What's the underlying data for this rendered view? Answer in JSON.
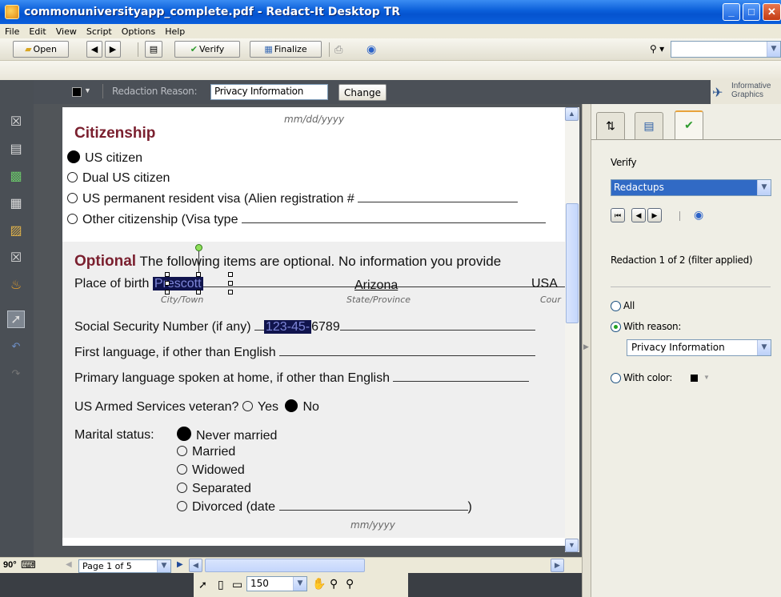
{
  "window": {
    "title": "commonuniversityapp_complete.pdf - Redact-It Desktop TR"
  },
  "menu": [
    "File",
    "Edit",
    "View",
    "Script",
    "Options",
    "Help"
  ],
  "toolbar": {
    "open": "Open",
    "verify": "Verify",
    "finalize": "Finalize"
  },
  "redaction_bar": {
    "reason_label": "Redaction Reason:",
    "reason_value": "Privacy Information",
    "change_button": "Change",
    "brand": "Informative Graphics"
  },
  "document": {
    "date_hint": "mm/dd/yyyy",
    "citizenship_heading": "Citizenship",
    "citizen_options": [
      "US citizen",
      "Dual US citizen",
      "US permanent resident visa (Alien registration # ",
      "Other citizenship (Visa type "
    ],
    "optional_title": "Optional",
    "optional_text": " The following items are optional. No information you provide ",
    "birth_label": "Place of birth ",
    "birth_city": "Prescott",
    "birth_state": "Arizona",
    "birth_country": "USA",
    "city_hint": "City/Town",
    "state_hint": "State/Province",
    "country_hint": "Cour",
    "ssn_label": "Social Security Number (if any) ",
    "ssn_redacted": "123-45-",
    "ssn_rest": "6789",
    "first_language": "First language, if other than English ",
    "home_language": "Primary language spoken at home, if other than English ",
    "veteran_label": "US Armed Services veteran? ",
    "veteran_yes": "Yes",
    "veteran_no": "No",
    "marital_label": "Marital status:",
    "marital_options": [
      "Never married",
      "Married",
      "Widowed",
      "Separated",
      "Divorced (date "
    ],
    "marital_close": ")",
    "month_year_hint": "mm/yyyy"
  },
  "bottom": {
    "rotation": "90°",
    "page_indicator": "Page 1 of 5",
    "zoom": "150"
  },
  "panel": {
    "verify_label": "Verify",
    "verify_select": "Redactups",
    "redaction_status": "Redaction 1 of 2 (filter applied)",
    "filter_all": "All",
    "filter_reason": "With reason:",
    "reason_select": "Privacy Information",
    "filter_color": "With color:"
  },
  "colors": {
    "redaction": "#10144d",
    "heading": "#7a1f2e",
    "title_bar": "#0a5ed9"
  }
}
